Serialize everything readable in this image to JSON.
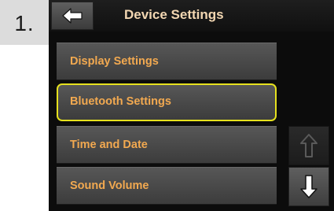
{
  "step": {
    "number": "1."
  },
  "header": {
    "title": "Device Settings",
    "back_icon": "arrow-left-icon"
  },
  "menu": {
    "items": [
      {
        "label": "Display Settings",
        "selected": false
      },
      {
        "label": "Bluetooth Settings",
        "selected": true
      },
      {
        "label": "Time and Date",
        "selected": false
      },
      {
        "label": "Sound Volume",
        "selected": false
      }
    ]
  },
  "scroll": {
    "up_icon": "arrow-up-icon",
    "down_icon": "arrow-down-icon",
    "up_enabled": false,
    "down_enabled": true
  },
  "colors": {
    "title_text": "#f3d7b2",
    "item_text": "#f2a950",
    "selection_outline": "#e6e11e",
    "screen_background": "#0c0c0c"
  }
}
